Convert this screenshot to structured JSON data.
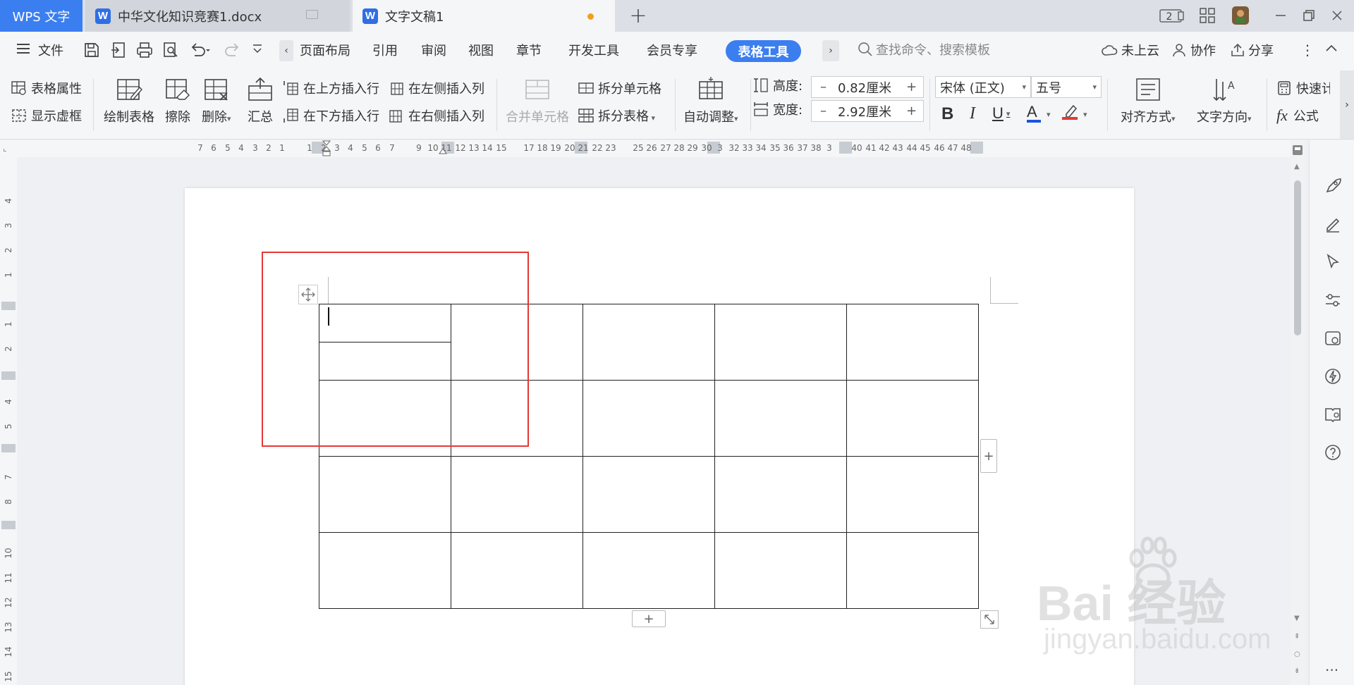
{
  "tabs": {
    "app_name": "WPS 文字",
    "documents": [
      {
        "name": "中华文化知识竞赛1.docx",
        "active": false
      },
      {
        "name": "文字文稿1",
        "active": true,
        "unsaved": true
      }
    ],
    "add_tab": "+",
    "window_count": "2"
  },
  "menu": {
    "file": "文件",
    "items": [
      "页面布局",
      "引用",
      "审阅",
      "视图",
      "章节",
      "开发工具",
      "会员专享"
    ],
    "active_context": "表格工具",
    "search_placeholder": "查找命令、搜索模板",
    "cloud": "未上云",
    "collab": "协作",
    "share": "分享"
  },
  "ribbon": {
    "table_props": "表格属性",
    "show_gridlines": "显示虚框",
    "draw_table": "绘制表格",
    "erase": "擦除",
    "delete": "删除",
    "summary": "汇总",
    "insert_above": "在上方插入行",
    "insert_below": "在下方插入行",
    "insert_left": "在左侧插入列",
    "insert_right": "在右侧插入列",
    "merge_cells": "合并单元格",
    "split_cells": "拆分单元格",
    "split_table": "拆分表格",
    "auto_fit": "自动调整",
    "height_label": "高度:",
    "height_value": "0.82厘米",
    "width_label": "宽度:",
    "width_value": "2.92厘米",
    "font_name": "宋体 (正文)",
    "font_size": "五号",
    "bold": "B",
    "italic": "I",
    "underline": "U",
    "font_color": "A",
    "align": "对齐方式",
    "text_direction": "文字方向",
    "quick_calc": "快速计算",
    "formula": "公式",
    "formula_icon": "fx"
  },
  "ruler": {
    "h_numbers": [
      "7",
      "6",
      "5",
      "4",
      "3",
      "2",
      "1",
      "1",
      "2",
      "3",
      "4",
      "5",
      "6",
      "7",
      "9",
      "10",
      "11",
      "12",
      "13",
      "14",
      "15",
      "17",
      "18",
      "19",
      "20",
      "21",
      "22",
      "23",
      "25",
      "26",
      "27",
      "28",
      "29",
      "30",
      "3",
      "32",
      "33",
      "34",
      "35",
      "36",
      "37",
      "38",
      "3",
      "40",
      "41",
      "42",
      "43",
      "44",
      "45",
      "46",
      "47",
      "48"
    ],
    "v_numbers": [
      "4",
      "3",
      "2",
      "1",
      "1",
      "2",
      "4",
      "5",
      "7",
      "8",
      "10",
      "11",
      "12",
      "13",
      "14",
      "15"
    ]
  },
  "table": {
    "rows": 4,
    "cols": 5,
    "cursor_cell": "r0c0",
    "split_cell": "r0c0"
  },
  "handles": {
    "add_col": "+",
    "add_row": "+"
  },
  "watermark": {
    "brand": "Bai 经验",
    "url": "jingyan.baidu.com"
  },
  "colors": {
    "accent": "#3b7ef0",
    "highlight_box": "#e53935",
    "font_color_bar": "#1a56db",
    "highlight_color_bar": "#e53935"
  }
}
